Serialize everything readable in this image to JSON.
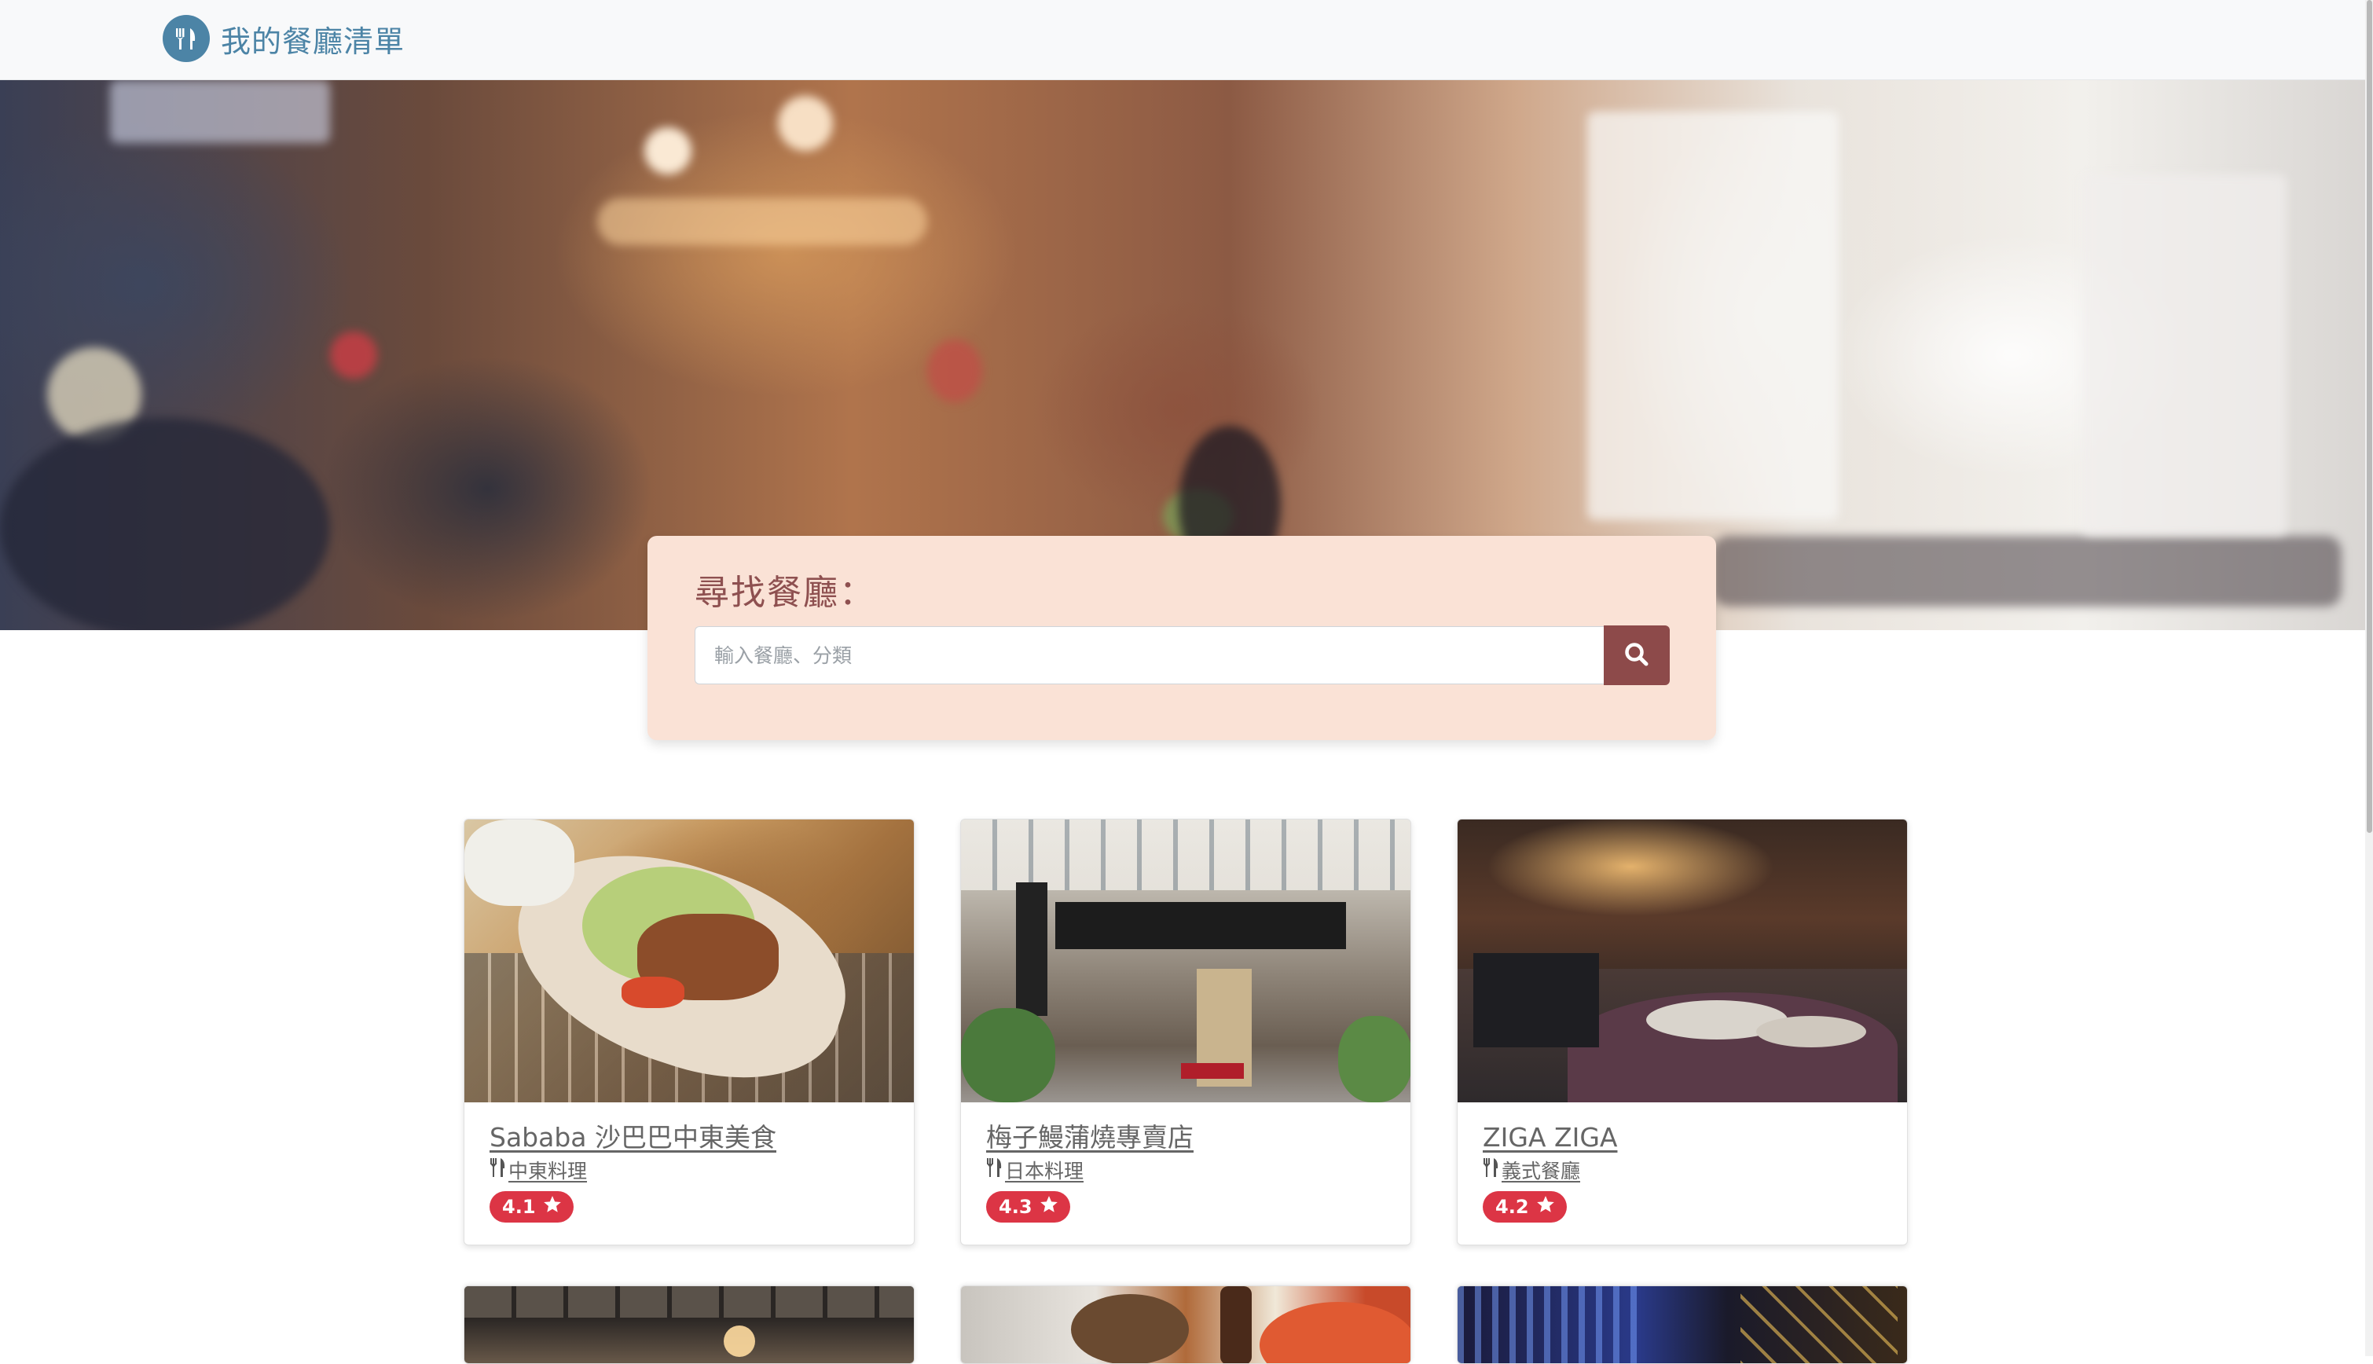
{
  "navbar": {
    "brand_title": "我的餐廳清單",
    "brand_icon": "utensils-icon"
  },
  "search": {
    "title": "尋找餐廳：",
    "placeholder": "輸入餐廳、分類",
    "button_icon": "search-icon"
  },
  "restaurants": [
    {
      "name": "Sababa 沙巴巴中東美食",
      "category": "中東料理",
      "rating": "4.1"
    },
    {
      "name": "梅子鰻蒲燒專賣店",
      "category": "日本料理",
      "rating": "4.3"
    },
    {
      "name": "ZIGA ZIGA",
      "category": "義式餐廳",
      "rating": "4.2"
    }
  ],
  "colors": {
    "brand": "#4c84a6",
    "search_panel": "#fae2d6",
    "search_title": "#8e5050",
    "search_button": "#8d4a4a",
    "rating_badge": "#dc3545"
  }
}
